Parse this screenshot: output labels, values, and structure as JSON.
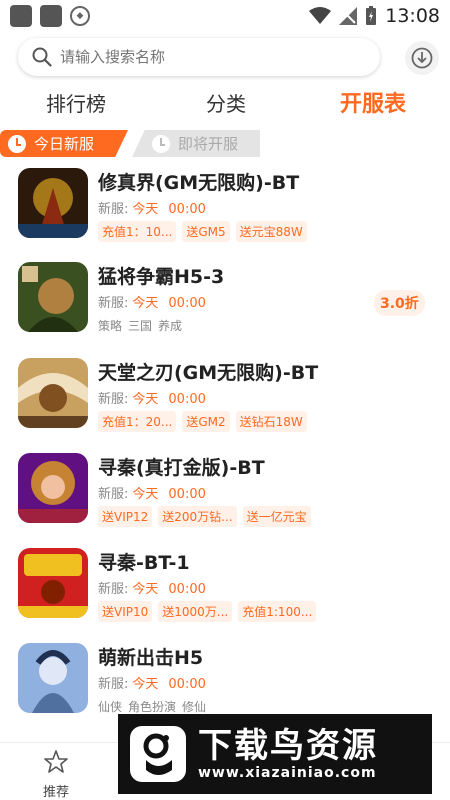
{
  "status_bar": {
    "time": "13:08"
  },
  "search": {
    "placeholder": "请输入搜索名称"
  },
  "top_tabs": [
    {
      "label": "排行榜"
    },
    {
      "label": "分类"
    },
    {
      "label": "开服表"
    }
  ],
  "sub_tabs": [
    {
      "label": "今日新服"
    },
    {
      "label": "即将开服"
    }
  ],
  "games": [
    {
      "name": "修真界(GM无限购)-BT",
      "server_label": "新服:",
      "server_day": "今天",
      "server_time": "00:00",
      "tags": [
        "充值1：10...",
        "送GM5",
        "送元宝88W"
      ],
      "icon_colors": [
        "#2b1a0c",
        "#d8a020",
        "#8a2a10"
      ]
    },
    {
      "name": "猛将争霸H5-3",
      "server_label": "新服:",
      "server_day": "今天",
      "server_time": "00:00",
      "plain_tags": [
        "策略",
        "三国",
        "养成"
      ],
      "discount": "3.0折",
      "icon_colors": [
        "#3a5020",
        "#b08040",
        "#203010"
      ]
    },
    {
      "name": "天堂之刃(GM无限购)-BT",
      "server_label": "新服:",
      "server_day": "今天",
      "server_time": "00:00",
      "tags": [
        "充值1：20...",
        "送GM2",
        "送钻石18W"
      ],
      "icon_colors": [
        "#c8a060",
        "#f0e0c0",
        "#805020"
      ]
    },
    {
      "name": "寻秦(真打金版)-BT",
      "server_label": "新服:",
      "server_day": "今天",
      "server_time": "00:00",
      "tags": [
        "送VIP12",
        "送200万钻...",
        "送一亿元宝"
      ],
      "icon_colors": [
        "#601080",
        "#e0a020",
        "#a02040"
      ]
    },
    {
      "name": "寻秦-BT-1",
      "server_label": "新服:",
      "server_day": "今天",
      "server_time": "00:00",
      "tags": [
        "送VIP10",
        "送1000万...",
        "充值1:100..."
      ],
      "icon_colors": [
        "#d02020",
        "#f0c020",
        "#802000"
      ]
    },
    {
      "name": "萌新出击H5",
      "server_label": "新服:",
      "server_day": "今天",
      "server_time": "00:00",
      "plain_tags": [
        "仙侠",
        "角色扮演",
        "修仙"
      ],
      "icon_colors": [
        "#90b0e0",
        "#e0e8f8",
        "#5070a0"
      ]
    }
  ],
  "bottom_nav": {
    "home_label": "推荐"
  },
  "watermark": {
    "title": "下载鸟资源",
    "url": "www.xiazainiao.com"
  },
  "colors": {
    "accent": "#ff6a21",
    "tag_bg": "#fff0e8"
  }
}
